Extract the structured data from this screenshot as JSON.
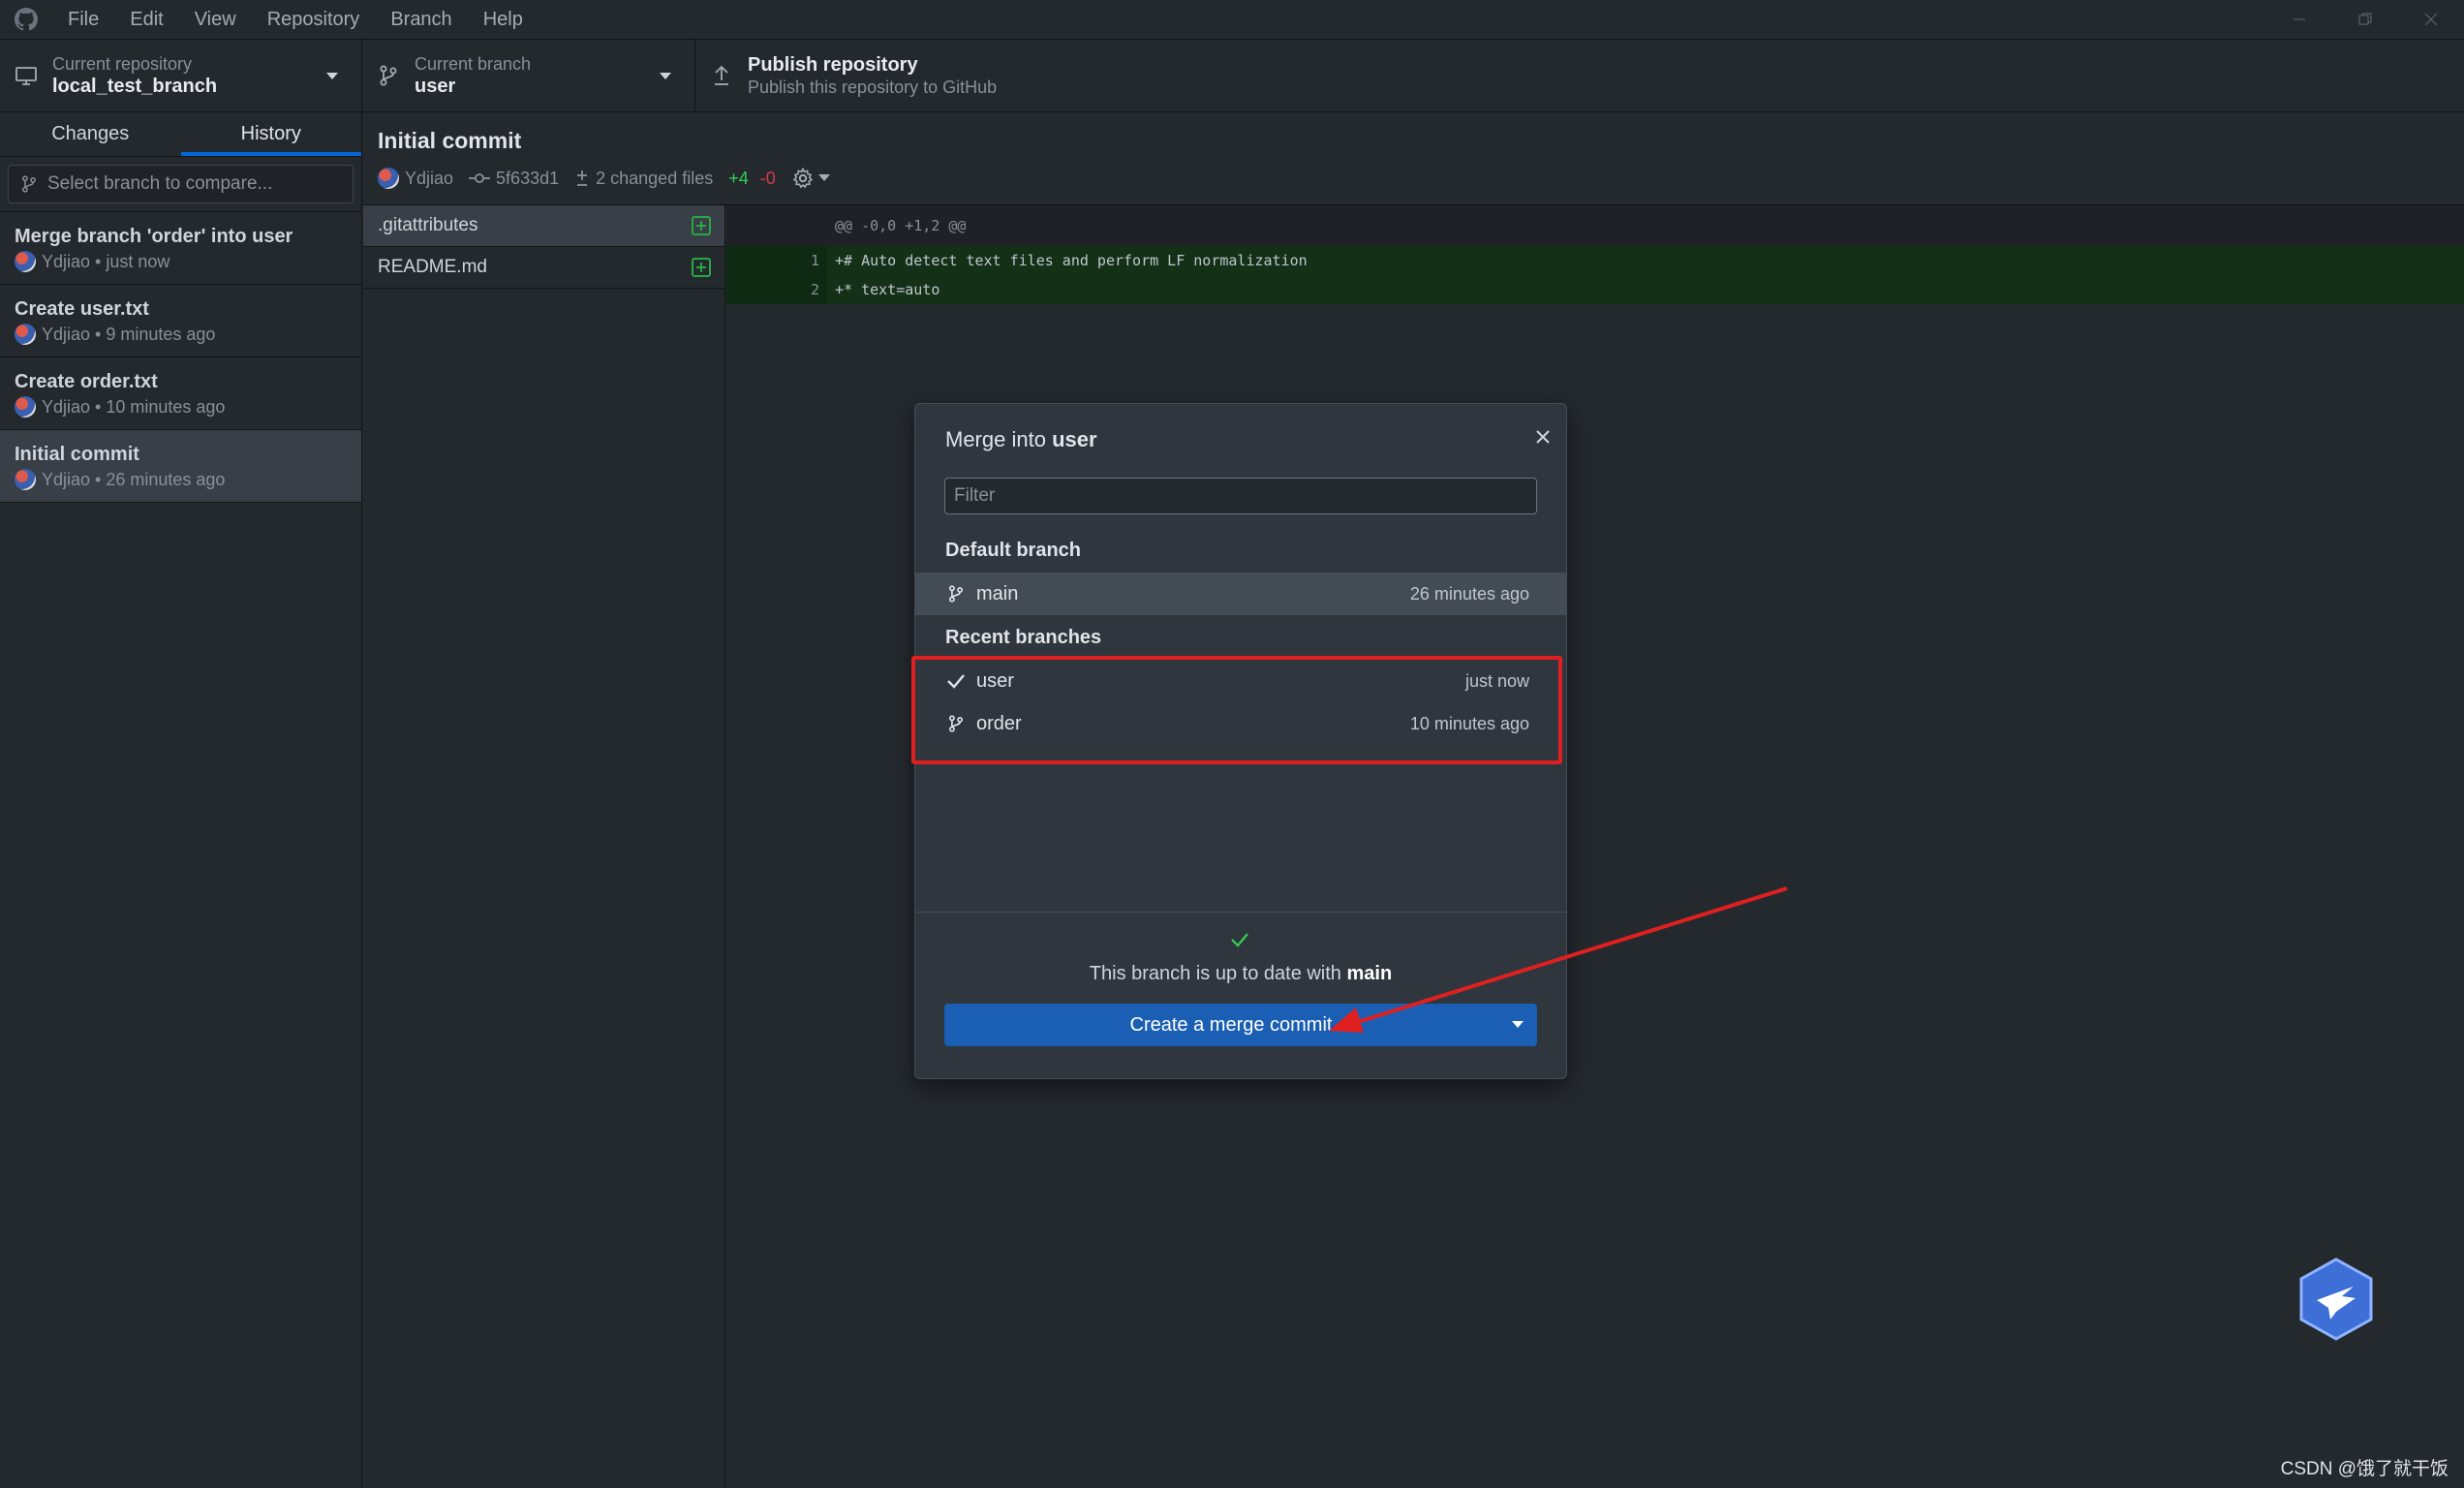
{
  "menu": [
    "File",
    "Edit",
    "View",
    "Repository",
    "Branch",
    "Help"
  ],
  "toolbar": {
    "repo_label": "Current repository",
    "repo_value": "local_test_branch",
    "branch_label": "Current branch",
    "branch_value": "user",
    "publish_title": "Publish repository",
    "publish_desc": "Publish this repository to GitHub"
  },
  "sidebar": {
    "tabs": [
      "Changes",
      "History"
    ],
    "active_tab": "History",
    "compare_placeholder": "Select branch to compare...",
    "commits": [
      {
        "title": "Merge branch 'order' into user",
        "meta": "Ydjiao • just now"
      },
      {
        "title": "Create user.txt",
        "meta": "Ydjiao • 9 minutes ago"
      },
      {
        "title": "Create order.txt",
        "meta": "Ydjiao • 10 minutes ago"
      },
      {
        "title": "Initial commit",
        "meta": "Ydjiao • 26 minutes ago"
      }
    ]
  },
  "details": {
    "title": "Initial commit",
    "author": "Ydjiao",
    "sha": "5f633d1",
    "changed": "2 changed files",
    "additions": "+4",
    "deletions": "-0"
  },
  "files": [
    ".gitattributes",
    "README.md"
  ],
  "diff": {
    "hunk": "@@ -0,0 +1,2 @@",
    "lines": [
      {
        "num": "1",
        "text": "+# Auto detect text files and perform LF normalization"
      },
      {
        "num": "2",
        "text": "+* text=auto"
      }
    ]
  },
  "modal": {
    "title_prefix": "Merge into",
    "title_branch": "user",
    "filter_placeholder": "Filter",
    "default_label": "Default branch",
    "default_branch": {
      "name": "main",
      "time": "26 minutes ago"
    },
    "recent_label": "Recent branches",
    "recent": [
      {
        "name": "user",
        "time": "just now",
        "icon": "check-icon"
      },
      {
        "name": "order",
        "time": "10 minutes ago",
        "icon": "branch-icon"
      }
    ],
    "status_prefix": "This branch is up to date with",
    "status_branch": "main",
    "merge_button": "Create a merge commit"
  },
  "watermark": "CSDN @饿了就干饭",
  "colors": {
    "accent": "#0366d6",
    "merge_button": "#1a5fb4",
    "annotation": "#e02020",
    "added": "#28a745"
  }
}
